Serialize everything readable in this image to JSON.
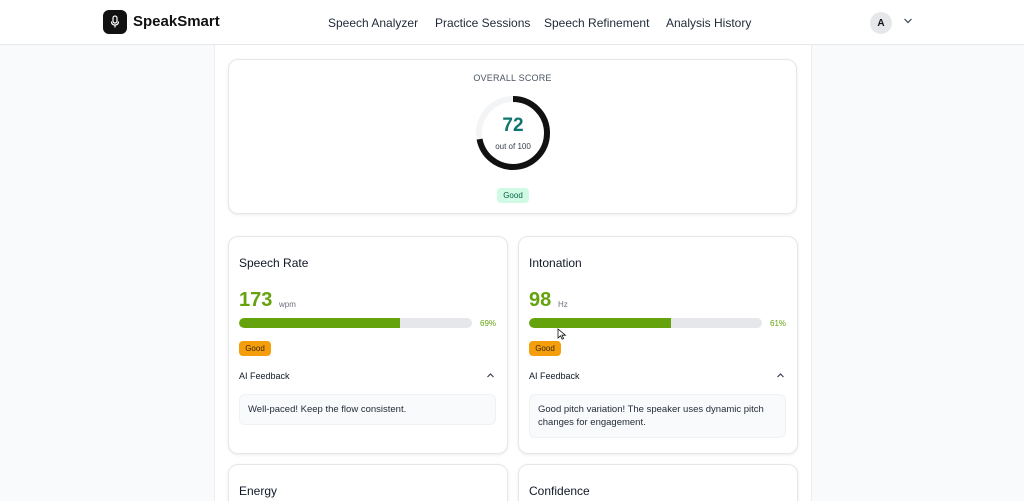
{
  "app": {
    "name": "SpeakSmart",
    "logo_icon": "microphone-icon"
  },
  "nav": {
    "items": [
      {
        "label": "Speech Analyzer"
      },
      {
        "label": "Practice Sessions"
      },
      {
        "label": "Speech Refinement"
      },
      {
        "label": "Analysis History"
      }
    ]
  },
  "user": {
    "initial": "A"
  },
  "overall": {
    "label": "OVERALL SCORE",
    "score": "72",
    "out_of": "out of 100",
    "rating": "Good",
    "fraction": 0.72,
    "ring_color": "#111111",
    "score_color": "#0f766e"
  },
  "metrics": [
    {
      "title": "Speech Rate",
      "value": "173",
      "unit": "wpm",
      "percent_label": "69%",
      "fraction": 0.69,
      "rating": "Good",
      "feedback_title": "AI Feedback",
      "feedback": "Well-paced! Keep the flow consistent."
    },
    {
      "title": "Intonation",
      "value": "98",
      "unit": "Hz",
      "percent_label": "61%",
      "fraction": 0.61,
      "rating": "Good",
      "feedback_title": "AI Feedback",
      "feedback": "Good pitch variation! The speaker uses dynamic pitch changes for engagement."
    },
    {
      "title": "Energy"
    },
    {
      "title": "Confidence"
    }
  ],
  "colors": {
    "accent_green": "#65a30d",
    "badge_amber": "#f59e0b",
    "badge_green_bg": "#d1fae5"
  }
}
